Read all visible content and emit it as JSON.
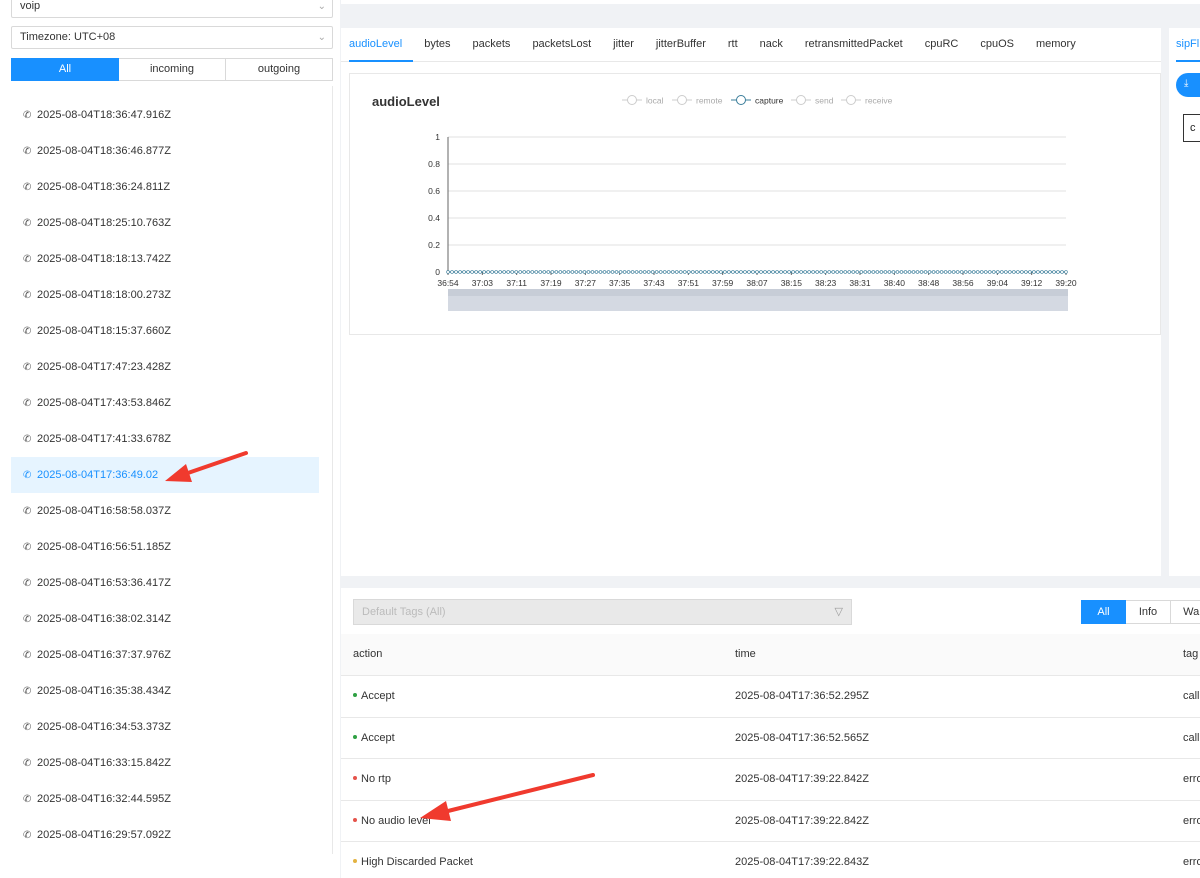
{
  "sidebar": {
    "app_select": "voip",
    "timezone_select": "Timezone: UTC+08",
    "direction_tabs": [
      "All",
      "incoming",
      "outgoing"
    ],
    "active_direction": "All",
    "calls": [
      "2025-08-04T18:36:47.916Z",
      "2025-08-04T18:36:46.877Z",
      "2025-08-04T18:36:24.811Z",
      "2025-08-04T18:25:10.763Z",
      "2025-08-04T18:18:13.742Z",
      "2025-08-04T18:18:00.273Z",
      "2025-08-04T18:15:37.660Z",
      "2025-08-04T17:47:23.428Z",
      "2025-08-04T17:43:53.846Z",
      "2025-08-04T17:41:33.678Z",
      "2025-08-04T17:36:49.02",
      "2025-08-04T16:58:58.037Z",
      "2025-08-04T16:56:51.185Z",
      "2025-08-04T16:53:36.417Z",
      "2025-08-04T16:38:02.314Z",
      "2025-08-04T16:37:37.976Z",
      "2025-08-04T16:35:38.434Z",
      "2025-08-04T16:34:53.373Z",
      "2025-08-04T16:33:15.842Z",
      "2025-08-04T16:32:44.595Z",
      "2025-08-04T16:29:57.092Z"
    ],
    "selected_index": 10
  },
  "metrics": {
    "tabs": [
      "audioLevel",
      "bytes",
      "packets",
      "packetsLost",
      "jitter",
      "jitterBuffer",
      "rtt",
      "nack",
      "retransmittedPacket",
      "cpuRC",
      "cpuOS",
      "memory"
    ],
    "active": "audioLevel"
  },
  "right_panel": {
    "tab_label": "sipFl",
    "box_text": "c"
  },
  "chart_data": {
    "type": "line",
    "title": "audioLevel",
    "legend": [
      "local",
      "remote",
      "capture",
      "send",
      "receive"
    ],
    "legend_active": "capture",
    "legend_placement": "top",
    "x_ticks": [
      "36:54",
      "37:03",
      "37:11",
      "37:19",
      "37:27",
      "37:35",
      "37:43",
      "37:51",
      "37:59",
      "38:07",
      "38:15",
      "38:23",
      "38:31",
      "38:40",
      "38:48",
      "38:56",
      "39:04",
      "39:12",
      "39:20"
    ],
    "y_ticks": [
      "1",
      "0.8",
      "0.6",
      "0.4",
      "0.2",
      "0"
    ],
    "ylim": [
      0,
      1
    ],
    "series": [
      {
        "name": "capture",
        "values": [
          0,
          0,
          0,
          0,
          0,
          0,
          0,
          0,
          0,
          0,
          0,
          0,
          0,
          0,
          0,
          0,
          0,
          0,
          0,
          0,
          0,
          0,
          0,
          0,
          0,
          0,
          0,
          0,
          0,
          0,
          0,
          0,
          0,
          0,
          0,
          0,
          0,
          0,
          0,
          0,
          0,
          0,
          0,
          0,
          0,
          0,
          0,
          0,
          0,
          0,
          0,
          0,
          0,
          0,
          0,
          0,
          0,
          0,
          0,
          0,
          0,
          0,
          0,
          0,
          0,
          0,
          0,
          0,
          0,
          0,
          0,
          0,
          0,
          0,
          0,
          0,
          0,
          0,
          0,
          0,
          0,
          0,
          0,
          0,
          0,
          0,
          0,
          0,
          0,
          0,
          0,
          0,
          0,
          0,
          0,
          0,
          0,
          0,
          0,
          0,
          0,
          0,
          0,
          0,
          0,
          0,
          0,
          0,
          0,
          0,
          0,
          0,
          0,
          0,
          0,
          0,
          0,
          0,
          0,
          0,
          0,
          0,
          0,
          0,
          0,
          0,
          0,
          0,
          0,
          0,
          0,
          0,
          0,
          0,
          0,
          0,
          0,
          0,
          0,
          0,
          0,
          0,
          0,
          0,
          0,
          0,
          0,
          0,
          0,
          0,
          0,
          0,
          0,
          0,
          0
        ]
      }
    ],
    "colors": {
      "capture": "#3a7d9a",
      "inactive": "#cccccc"
    },
    "grid": true
  },
  "logs": {
    "tag_filter_placeholder": "Default Tags (All)",
    "level_tabs": [
      "All",
      "Info",
      "War"
    ],
    "active_level": "All",
    "columns": {
      "action": "action",
      "time": "time",
      "tag": "tag"
    },
    "rows": [
      {
        "action": "Accept",
        "time": "2025-08-04T17:36:52.295Z",
        "tag": "call",
        "level_color": "#2ea043"
      },
      {
        "action": "Accept",
        "time": "2025-08-04T17:36:52.565Z",
        "tag": "call",
        "level_color": "#2ea043"
      },
      {
        "action": "No rtp",
        "time": "2025-08-04T17:39:22.842Z",
        "tag": "erro",
        "level_color": "#e5534b"
      },
      {
        "action": "No audio level",
        "time": "2025-08-04T17:39:22.842Z",
        "tag": "erro",
        "level_color": "#e5534b"
      },
      {
        "action": "High Discarded Packet",
        "time": "2025-08-04T17:39:22.843Z",
        "tag": "erro",
        "level_color": "#e3b341"
      }
    ]
  },
  "colors": {
    "accent": "#1890ff",
    "annotation_arrow": "#f03a2e"
  }
}
